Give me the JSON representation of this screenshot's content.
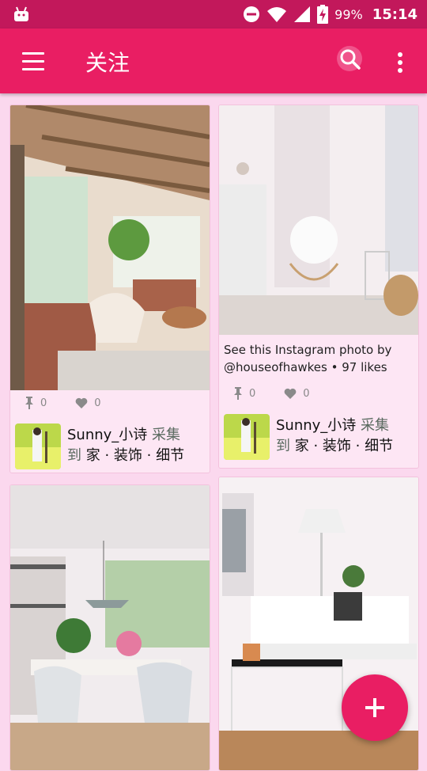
{
  "status_bar": {
    "battery_percent": "99%",
    "time": "15:14",
    "icons": [
      "android-icon",
      "do-not-disturb-icon",
      "wifi-icon",
      "signal-icon",
      "battery-charging-icon"
    ]
  },
  "app_bar": {
    "title": "关注",
    "icons": [
      "menu-icon",
      "search-icon",
      "more-vert-icon"
    ]
  },
  "feed": {
    "cards": [
      {
        "caption": "",
        "pins": "0",
        "likes": "0",
        "user": "Sunny_小诗",
        "action": "采集",
        "to": "到",
        "board": "家 · 装饰 · 细节"
      },
      {
        "caption": "See this Instagram photo by @houseofhawkes • 97 likes",
        "pins": "0",
        "likes": "0",
        "user": "Sunny_小诗",
        "action": "采集",
        "to": "到",
        "board": "家 · 装饰 · 细节"
      }
    ]
  },
  "fab": {
    "icon": "plus-icon"
  },
  "colors": {
    "primary": "#e91e63",
    "status_bar": "#c2185b",
    "background": "#fbd8ee"
  }
}
